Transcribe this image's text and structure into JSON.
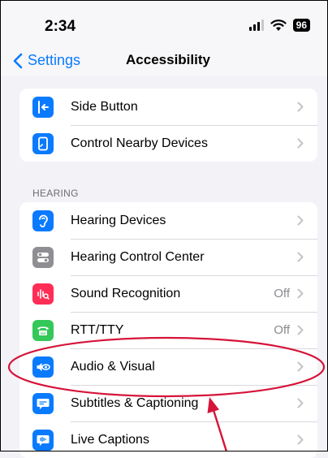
{
  "status_bar": {
    "time": "2:34",
    "battery": "96"
  },
  "nav": {
    "back_label": "Settings",
    "title": "Accessibility"
  },
  "group1": [
    {
      "label": "Side Button",
      "icon": "side-button-icon",
      "color": "#0a7aff"
    },
    {
      "label": "Control Nearby Devices",
      "icon": "nearby-devices-icon",
      "color": "#0a7aff"
    }
  ],
  "hearing_header": "HEARING",
  "hearing": [
    {
      "label": "Hearing Devices",
      "value": "",
      "icon": "ear-icon",
      "color": "#0a7aff"
    },
    {
      "label": "Hearing Control Center",
      "value": "",
      "icon": "toggles-icon",
      "color": "#8e8e93"
    },
    {
      "label": "Sound Recognition",
      "value": "Off",
      "icon": "sound-recognition-icon",
      "color": "#ff2d55"
    },
    {
      "label": "RTT/TTY",
      "value": "Off",
      "icon": "tty-icon",
      "color": "#34c759"
    },
    {
      "label": "Audio & Visual",
      "value": "",
      "icon": "audio-visual-icon",
      "color": "#0a7aff"
    },
    {
      "label": "Subtitles & Captioning",
      "value": "",
      "icon": "captions-icon",
      "color": "#0a7aff"
    },
    {
      "label": "Live Captions",
      "value": "",
      "icon": "live-captions-icon",
      "color": "#0a7aff"
    }
  ],
  "annotation_color": "#d6143a"
}
